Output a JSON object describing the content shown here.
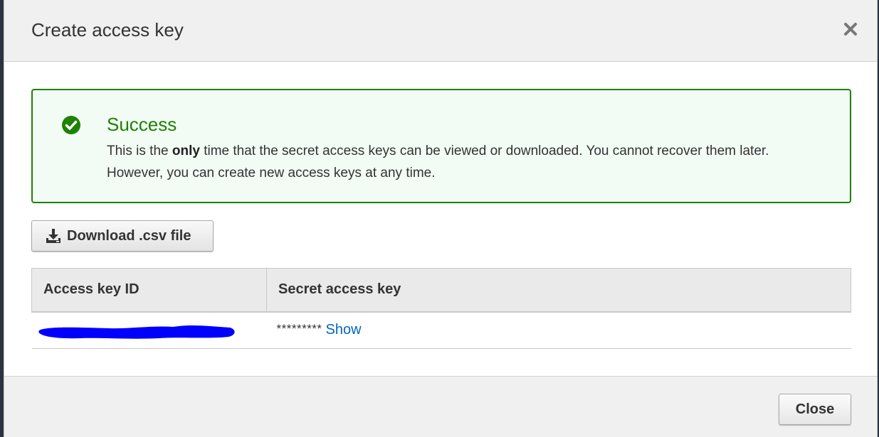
{
  "dialog": {
    "title": "Create access key",
    "close_icon": "close-icon"
  },
  "alert": {
    "icon": "check-circle-icon",
    "title": "Success",
    "body_part1": "This is the ",
    "body_bold": "only",
    "body_part2": " time that the secret access keys can be viewed or downloaded. You cannot recover them later. However, you can create new access keys at any time.",
    "accent_color": "#1d8102"
  },
  "download": {
    "icon": "download-icon",
    "label": "Download .csv file"
  },
  "table": {
    "headers": [
      "Access key ID",
      "Secret access key"
    ],
    "rows": [
      {
        "access_key_id_redacted": true,
        "secret_masked": "*********",
        "show_label": "Show"
      }
    ]
  },
  "footer": {
    "close_label": "Close"
  },
  "colors": {
    "link": "#0066c0",
    "redaction": "#0000ff"
  }
}
